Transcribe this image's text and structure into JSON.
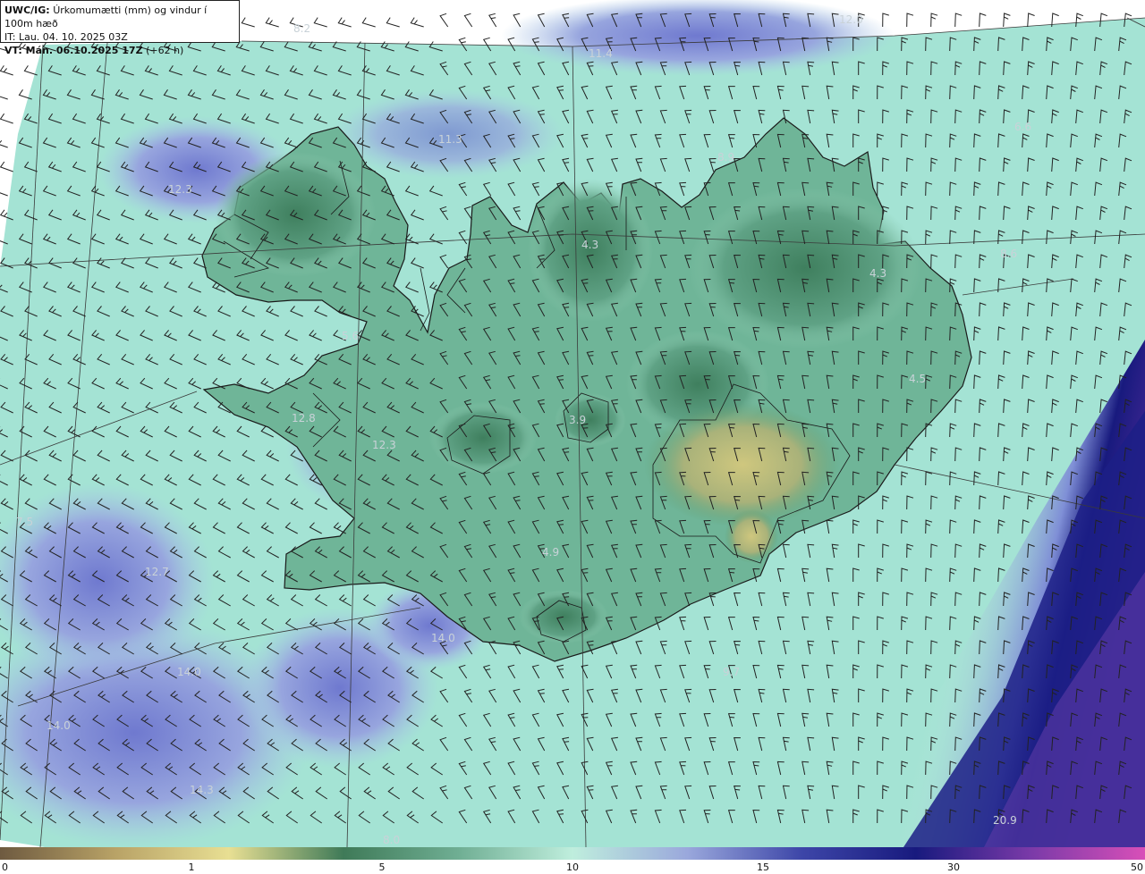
{
  "header": {
    "model_label": "UWC/IG:",
    "title": "Úrkomumætti (mm) og vindur í 100m hæð",
    "init_time": "IT: Lau. 04. 10. 2025 03Z",
    "valid_time": "VT: Mán. 06.10.2025 17Z",
    "lead_time": "(+62 h)"
  },
  "colorbar": {
    "ticks": [
      "0",
      "1",
      "5",
      "10",
      "15",
      "30",
      "50"
    ],
    "colors": [
      "#6e5a40",
      "#b8a266",
      "#e8df93",
      "#3f7a58",
      "#6fae93",
      "#bfeedd",
      "#9aa8dc",
      "#3d46a8",
      "#181a7e",
      "#7a3aa8",
      "#d84fb8"
    ]
  },
  "map": {
    "land_outline_color": "#1a1a1a",
    "graticule_color": "#3a3a3a",
    "values": [
      {
        "id": "v1",
        "text": "8.2"
      },
      {
        "id": "v2",
        "text": "12.0"
      },
      {
        "id": "v3",
        "text": "11.4"
      },
      {
        "id": "v4",
        "text": "11.3"
      },
      {
        "id": "v5",
        "text": "6.6"
      },
      {
        "id": "v6",
        "text": "12.3"
      },
      {
        "id": "v7",
        "text": "8.9"
      },
      {
        "id": "v8",
        "text": "4.3"
      },
      {
        "id": "v9",
        "text": "4.3"
      },
      {
        "id": "v10",
        "text": "8.6"
      },
      {
        "id": "v11",
        "text": "5.6"
      },
      {
        "id": "v12",
        "text": "4.5"
      },
      {
        "id": "v13",
        "text": "3.9"
      },
      {
        "id": "v14",
        "text": "12.8"
      },
      {
        "id": "v15",
        "text": "12.3"
      },
      {
        "id": "v16",
        "text": "7.5"
      },
      {
        "id": "v17",
        "text": "4.9"
      },
      {
        "id": "v18",
        "text": "12.7"
      },
      {
        "id": "v19",
        "text": "14.0"
      },
      {
        "id": "v20",
        "text": "14.0"
      },
      {
        "id": "v21",
        "text": "14.0"
      },
      {
        "id": "v22",
        "text": "9.7"
      },
      {
        "id": "v23",
        "text": "14.3"
      },
      {
        "id": "v24",
        "text": "20.9"
      },
      {
        "id": "v25",
        "text": "8.0"
      }
    ]
  }
}
